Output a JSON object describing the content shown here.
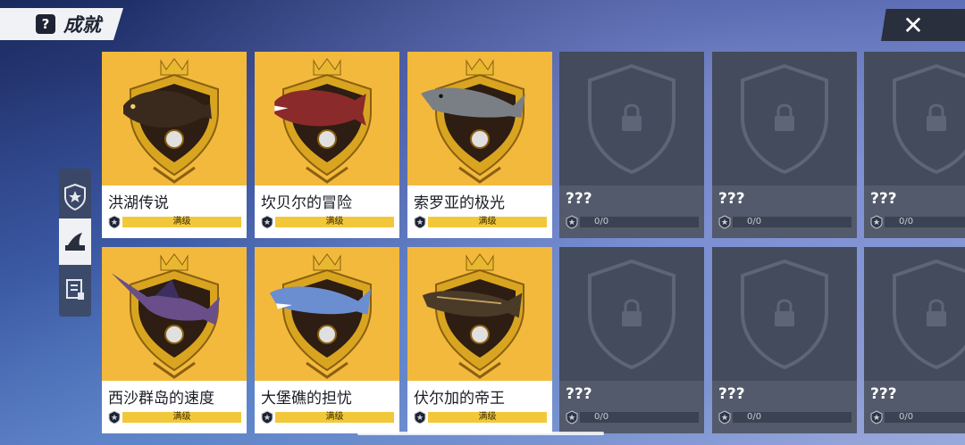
{
  "header": {
    "title": "成就",
    "help_glyph": "?",
    "close_glyph": "✕"
  },
  "side_tabs": [
    {
      "icon": "star-shield-icon",
      "active": false
    },
    {
      "icon": "shark-fin-icon",
      "active": true
    },
    {
      "icon": "book-icon",
      "active": false
    }
  ],
  "cards": [
    {
      "name": "洪湖传说",
      "progress_label": "满级",
      "progress": 1.0,
      "locked": false,
      "fish": "carp"
    },
    {
      "name": "坎贝尔的冒险",
      "progress_label": "满级",
      "progress": 1.0,
      "locked": false,
      "fish": "piranha"
    },
    {
      "name": "索罗亚的极光",
      "progress_label": "满级",
      "progress": 1.0,
      "locked": false,
      "fish": "shark-grey"
    },
    {
      "name": "???",
      "progress_label": "0/0",
      "progress": 0,
      "locked": true
    },
    {
      "name": "???",
      "progress_label": "0/0",
      "progress": 0,
      "locked": true
    },
    {
      "name": "???",
      "progress_label": "0/0",
      "progress": 0,
      "locked": true
    },
    {
      "name": "西沙群岛的速度",
      "progress_label": "满级",
      "progress": 1.0,
      "locked": false,
      "fish": "marlin"
    },
    {
      "name": "大堡礁的担忧",
      "progress_label": "满级",
      "progress": 1.0,
      "locked": false,
      "fish": "shark-blue"
    },
    {
      "name": "伏尔加的帝王",
      "progress_label": "满级",
      "progress": 1.0,
      "locked": false,
      "fish": "sturgeon"
    },
    {
      "name": "???",
      "progress_label": "0/0",
      "progress": 0,
      "locked": true
    },
    {
      "name": "???",
      "progress_label": "0/0",
      "progress": 0,
      "locked": true
    },
    {
      "name": "???",
      "progress_label": "0/0",
      "progress": 0,
      "locked": true
    }
  ],
  "colors": {
    "card_gold": "#f3b93d",
    "card_locked": "#434b5c",
    "progress_fill": "#f2c83a",
    "emblem_gold": "#d9a520",
    "emblem_dark": "#2d1d12"
  }
}
